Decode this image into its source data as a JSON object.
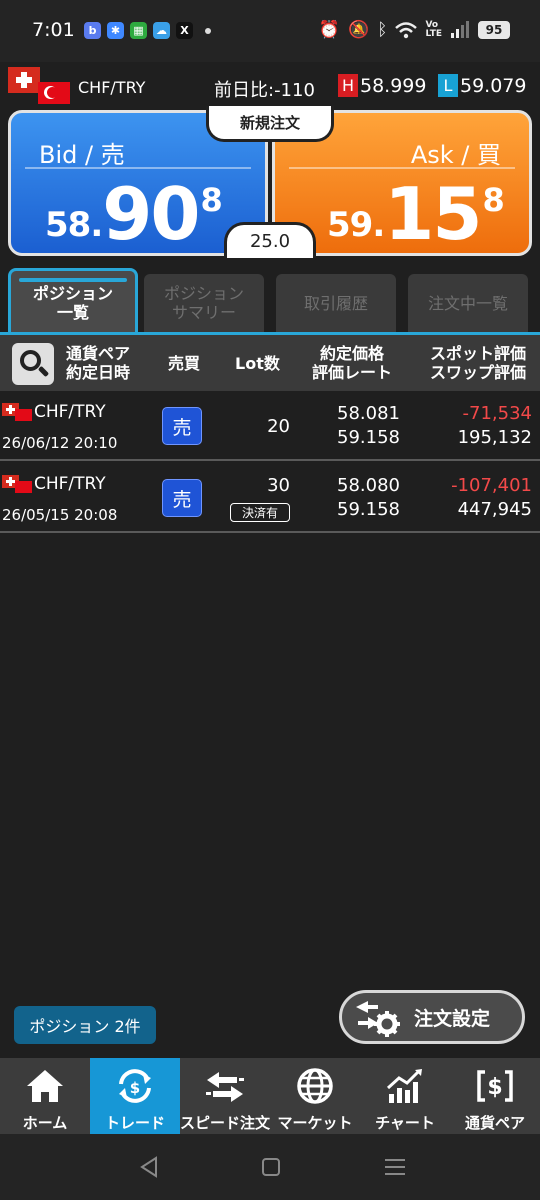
{
  "status_bar": {
    "time": "7:01",
    "battery": "95",
    "apps": [
      {
        "icon": "b-app-icon",
        "glyph": "b",
        "color": "#5a7bef"
      },
      {
        "icon": "pinwheel-app-icon",
        "glyph": "✱",
        "color": "#3f88ff"
      },
      {
        "icon": "calendar-app-icon",
        "glyph": "▦",
        "color": "#2eaa3f"
      },
      {
        "icon": "weather-app-icon",
        "glyph": "☁",
        "color": "#3aa0e8"
      },
      {
        "icon": "x-app-icon",
        "glyph": "𝕏",
        "color": "#111111"
      }
    ]
  },
  "header": {
    "pair": "CHF/TRY",
    "change_label": "前日比",
    "change_value": ":-110",
    "high_label": "H",
    "high_value": "58.999",
    "low_label": "L",
    "low_value": "59.079",
    "high_color": "#d81d22",
    "low_color": "#18a2d4"
  },
  "quote": {
    "bid_label": "Bid / 売",
    "bid_small": "58.",
    "bid_big": "90",
    "bid_sup": "8",
    "ask_label": "Ask / 買",
    "ask_small": "59.",
    "ask_big": "15",
    "ask_sup": "8",
    "new_order": "新規注文",
    "spread": "25.0"
  },
  "tabs": [
    {
      "label": "ポジション\n一覧"
    },
    {
      "label": "ポジション\nサマリー"
    },
    {
      "label": "取引履歴"
    },
    {
      "label": "注文中一覧"
    }
  ],
  "table_header": {
    "pair_date": "通貨ペア\n約定日時",
    "side": "売買",
    "lot": "Lot数",
    "price_rate": "約定価格\n評価レート",
    "spot_swap": "スポット評価\nスワップ評価"
  },
  "positions": [
    {
      "pair": "CHF/TRY",
      "date": "26/06/12 20:10",
      "side": "売",
      "lot": "20",
      "settled": "",
      "exec_price": "58.081",
      "rate": "59.158",
      "spot": "-71,534",
      "swap": "195,132"
    },
    {
      "pair": "CHF/TRY",
      "date": "26/05/15 20:08",
      "side": "売",
      "lot": "30",
      "settled": "決済有",
      "exec_price": "58.080",
      "rate": "59.158",
      "spot": "-107,401",
      "swap": "447,945"
    }
  ],
  "footer": {
    "position_count": "ポジション 2件",
    "order_settings": "注文設定"
  },
  "nav": [
    {
      "label": "ホーム",
      "icon": "home-icon"
    },
    {
      "label": "トレード",
      "icon": "trade-dollar-icon"
    },
    {
      "label": "スピード注文",
      "icon": "speed-order-icon"
    },
    {
      "label": "マーケット",
      "icon": "globe-icon"
    },
    {
      "label": "チャート",
      "icon": "chart-icon"
    },
    {
      "label": "通貨ペア",
      "icon": "currency-pair-icon"
    }
  ]
}
